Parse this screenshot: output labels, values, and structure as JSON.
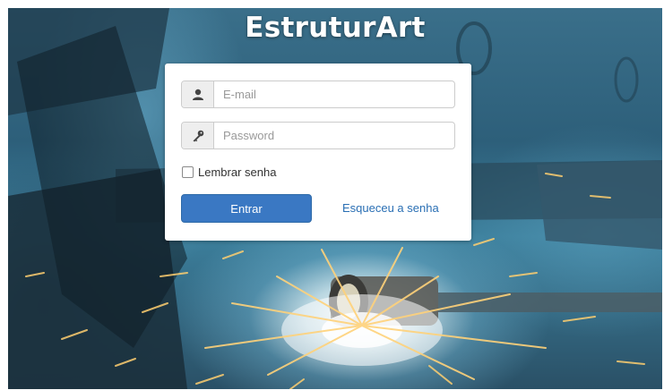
{
  "brand": {
    "title": "EstruturArt"
  },
  "login": {
    "email_placeholder": "E-mail",
    "password_placeholder": "Password",
    "remember_label": "Lembrar senha",
    "submit_label": "Entrar",
    "forgot_label": "Esqueceu a senha"
  },
  "icons": {
    "email": "user-icon",
    "password": "key-icon"
  },
  "colors": {
    "primary_button": "#3a78c3",
    "link": "#2a6fb4",
    "brand_text": "#ffffff"
  }
}
